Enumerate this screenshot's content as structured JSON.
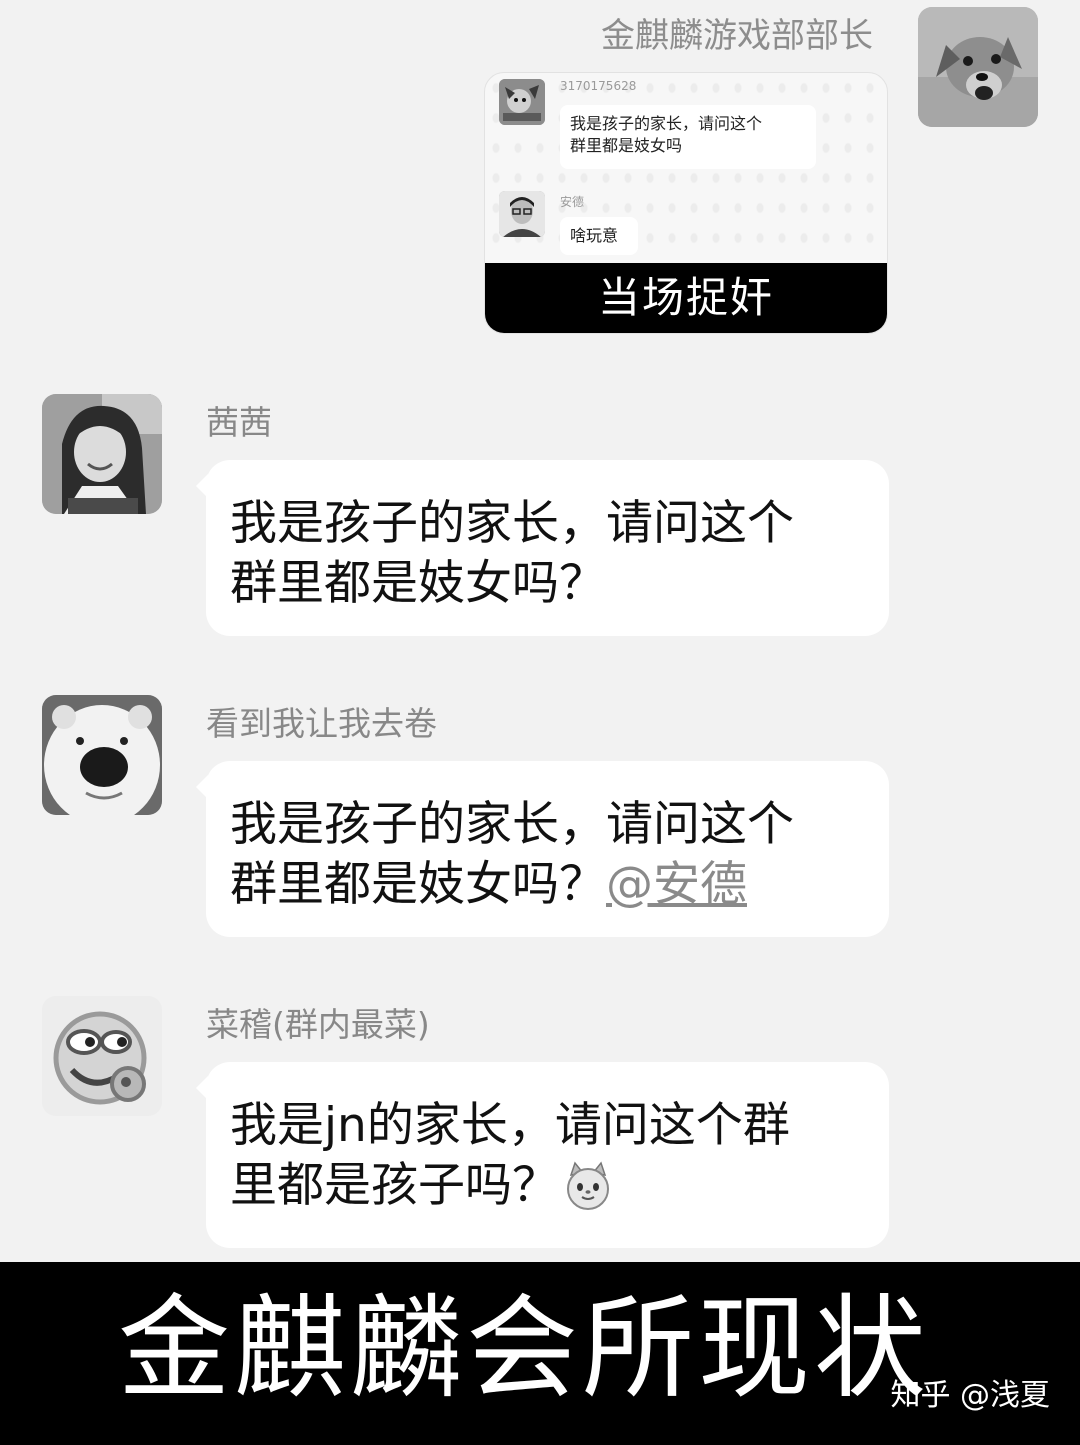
{
  "self_message": {
    "sender": "金麒麟游戏部部长",
    "avatar_icon": "dog-avatar",
    "quoted_image": {
      "messages": [
        {
          "sender": "3170175628",
          "avatar_icon": "cartoon-avatar",
          "text_line1": "我是孩子的家长，请问这个",
          "text_line2": "群里都是妓女吗"
        },
        {
          "sender": "安德",
          "avatar_icon": "person-avatar",
          "text_line1": "啥玩意"
        }
      ],
      "caption": "当场捉奸"
    }
  },
  "messages": [
    {
      "sender": "茜茜",
      "avatar_icon": "girl-avatar",
      "line1": "我是孩子的家长，请问这个",
      "line2": "群里都是妓女吗？"
    },
    {
      "sender": "看到我让我去卷",
      "avatar_icon": "white-bear-avatar",
      "line1": "我是孩子的家长，请问这个",
      "line2": "群里都是妓女吗？",
      "mention": "@安德"
    },
    {
      "sender": "菜稽(群内最菜)",
      "avatar_icon": "smirk-emoji-avatar",
      "line1": "我是jn的家长，请问这个群",
      "line2": "里都是孩子吗？",
      "emoji": "cat-face-emoji"
    }
  ],
  "footer": {
    "title": "金麒麟会所现状",
    "watermark": "知乎 @浅夏"
  }
}
